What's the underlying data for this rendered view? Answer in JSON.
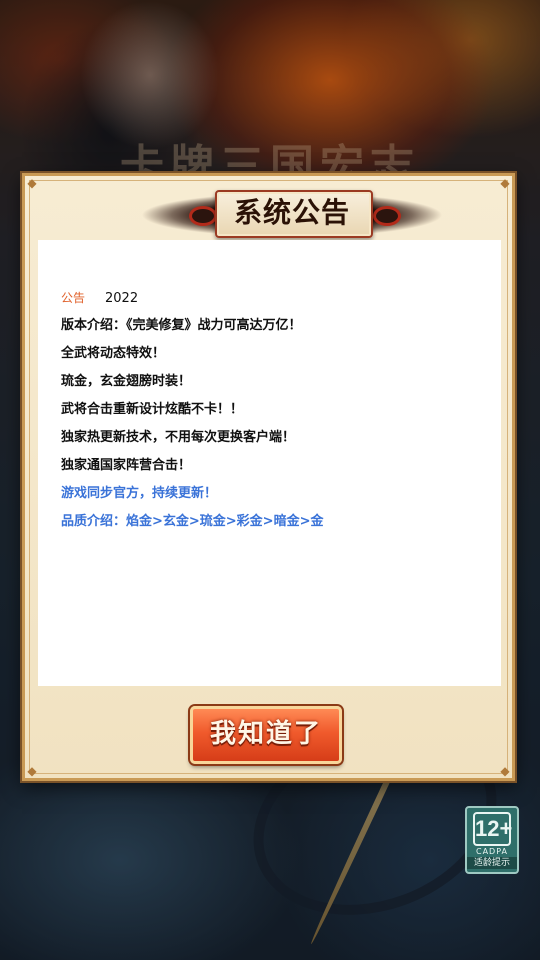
{
  "background": {
    "title_text": "卡牌三国宏志"
  },
  "dialog": {
    "title": "系统公告",
    "notice_tag": "公告",
    "notice_year": "2022",
    "lines": [
      "版本介绍：《完美修复》战力可高达万亿！",
      "全武将动态特效！",
      "琉金，玄金翅膀时装！",
      "武将合击重新设计炫酷不卡！！",
      "独家热更新技术，不用每次更换客户端！",
      "独家通国家阵营合击！"
    ],
    "blue_lines": [
      "游戏同步官方，持续更新！",
      "品质介绍：焰金>玄金>琉金>彩金>暗金>金"
    ],
    "confirm_label": "我知道了"
  },
  "age_rating": {
    "number": "12+",
    "org": "CADPA",
    "hint": "适龄提示"
  },
  "colors": {
    "notice_tag": "#e0602a",
    "highlight_text": "#3a73d8",
    "button": "#f05a2c",
    "panel_frame": "#c99a55"
  }
}
